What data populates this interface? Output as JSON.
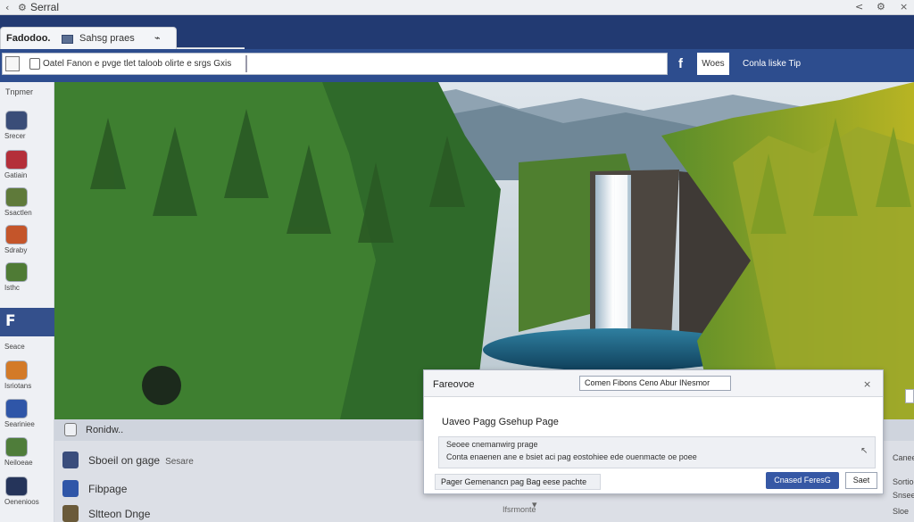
{
  "window": {
    "title": "Serral",
    "controls": [
      "‹",
      "⚙",
      "<",
      "⚙",
      "×"
    ]
  },
  "tab": {
    "title": "Fadodoo.",
    "page_label": "Sahsg praes",
    "icon_glyph": "⌁"
  },
  "toolbar": {
    "url": "Oatel Fanon e pvge tlet taloob olirte e srgs Gxis",
    "f_label": "f",
    "mid_button": "Woes",
    "right_text": "Conla liske Tip"
  },
  "sidebar": {
    "heading": "Tnpmer",
    "items": [
      {
        "label": "Srecer",
        "color": "#3a4d78",
        "glyph": ""
      },
      {
        "label": "Gatiain",
        "color": "#b42f3a",
        "glyph": ""
      },
      {
        "label": "Ssactlen",
        "color": "#5f7a3a",
        "glyph": ""
      },
      {
        "label": "Sdraby",
        "color": "#c4552a",
        "glyph": ""
      },
      {
        "label": "Isthc",
        "color": "#4f7b35",
        "glyph": ""
      },
      {
        "label": "",
        "color": "#34508c",
        "glyph": "F"
      },
      {
        "label": "Seace",
        "color": "",
        "glyph": ""
      },
      {
        "label": "Isriotans",
        "color": "#d37a28",
        "glyph": ""
      },
      {
        "label": "Seariniee",
        "color": "#2f56a8",
        "glyph": ""
      },
      {
        "label": "Neiloeae",
        "color": "#4f7d3a",
        "glyph": ""
      },
      {
        "label": "Oenenioos",
        "color": "#25345a",
        "glyph": ""
      }
    ]
  },
  "lower": {
    "header": "Ronidw..",
    "rows": [
      {
        "title": "Sboeil on gage",
        "sub": "Sesare",
        "color": "#3a4d7c"
      },
      {
        "title": "Fibpage",
        "sub": "",
        "color": "#2f56a8"
      },
      {
        "title": "Sltteon Dnge",
        "sub": "",
        "color": "#6a5a3a"
      }
    ],
    "footer": "Ifsrmonte"
  },
  "dialog": {
    "title": "Fareovoe",
    "chip": "Comen Fibons  Ceno  Abur INesmor",
    "close_glyph": "×",
    "subtitle": "Uaveo Pagg Gsehup Page",
    "box_line1": "Seoee cnemanwirg prage",
    "box_line2": "Conta enaenen ane e bsiet aci pag eostohiee ede ouenmacte oe poee",
    "pin_glyph": "↖",
    "footer": "Pager Gemenancn pag Bag eese pachte",
    "primary": "Cnased FeresG",
    "secondary": "Saet"
  },
  "rail": {
    "labels": [
      "Canee",
      "Sortioe",
      "Snseenh",
      "Sloe"
    ]
  }
}
